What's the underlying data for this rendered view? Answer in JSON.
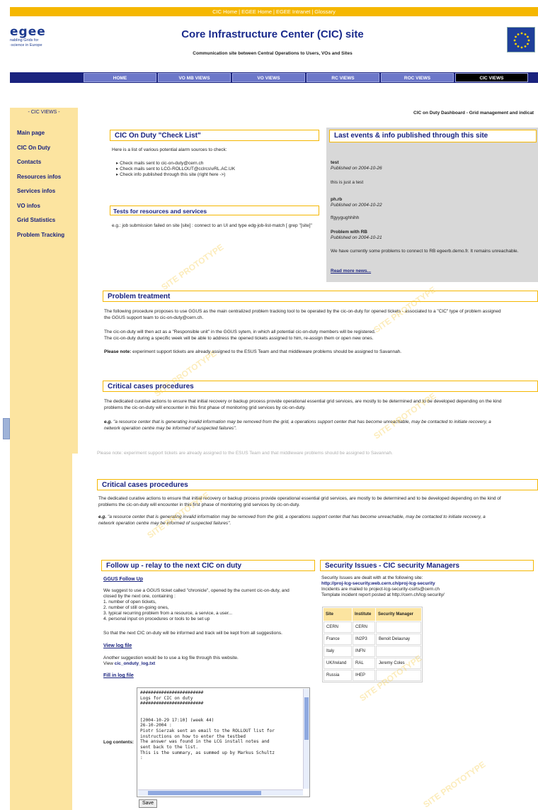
{
  "topbar": {
    "links": [
      "CIC Home",
      "EGEE Home",
      "EGEE Intranet",
      "Glossary"
    ],
    "separator": "|"
  },
  "logo": {
    "word": "egee",
    "tagline_1": "nabling Grids for",
    "tagline_2": "-science in Europe"
  },
  "header": {
    "title": "Core Infrastructure Center (CIC) site",
    "subtitle": "Communication site between Central Operations to Users, VOs and Sites"
  },
  "nav": {
    "items": [
      "HOME",
      "VO MB VIEWS",
      "VO VIEWS",
      "RC VIEWS",
      "ROC VIEWS",
      "CIC VIEWS"
    ],
    "active": "CIC VIEWS"
  },
  "sidebar": {
    "title": "- CIC VIEWS -",
    "items": [
      "Main page",
      "CIC On Duty",
      "Contacts",
      "Resources infos",
      "Services infos",
      "VO infos",
      "Grid Statistics",
      "Problem Tracking"
    ]
  },
  "breadcrumb": "CIC on Duty Dashboard - Grid management and indicat",
  "checklist": {
    "title": "CIC On Duty \"Check List\"",
    "intro": "Here is a list of various potential alarm sources to check:",
    "items": [
      "Check mails sent to cic-on-duty@cern.ch",
      "Check mails sent to LCG-ROLLOUT@cclrcs\\vRL.AC.UK",
      "Check info published through this site (right here ->)"
    ]
  },
  "tests": {
    "title": "Tests for resources and services",
    "text": "e.g.: job submission failed on site [site] : connect to an UI and type edg-job-list-match [ grep \"[site]\""
  },
  "events": {
    "title": "Last events & info published through this site",
    "entries": [
      {
        "name": "test",
        "published": "Published on 2004-10-26",
        "body": "this is just a test"
      },
      {
        "name": "ph.rb",
        "published": "Published on 2004-10-22",
        "body": "ffgyygughhihh"
      },
      {
        "name": "Problem with RB",
        "published": "Published on 2004-10-21",
        "body": "We have currently some problems to connect to RB egeerb.demo.fr. It remains unreachable."
      }
    ],
    "more": "Read more news..."
  },
  "problem": {
    "title": "Problem treatment",
    "p1": "The following procedure proposes to use GGUS as the main centralized problem tracking tool to be operated by the cic-on-duty for opened tickets - associated to a \"CIC\" type of problem assigned",
    "p1b": "the GGUS support team to cic-on-duty@cern.ch.",
    "p2": "The cic-on-duty will then act as a \"Responsible unit\" in the GGUS sytem, in which all potential cic-on-duty members will be registered.",
    "p3": "The cic-on-duty during a specific week will be able to address the opened tickets assigned to him, re-assign them or open new ones.",
    "note_label": "Please note:",
    "note": "experiment support tickets are already assigned to the ESUS Team and that middleware problems should be assigned to Savannah."
  },
  "critical": {
    "title": "Critical cases procedures",
    "p1": "The dedicated curative actions to ensure that initial recovery or backup process provide operational essential grid services, are mostly to be determined and to be developed depending on the kind",
    "p1b": "problems the cic-on-duty will encounter in this first phase of monitoring grid services by cic-on-duty.",
    "eg_label": "e.g.",
    "eg": "\"a resource center that is generating invalid information may be removed from the grid, a operations support center that has become unreachable, may be contacted to initiate recovery, a",
    "eg2": "network operation centre may be informed of suspected failures\"."
  },
  "critical2": {
    "title": "Critical cases procedures",
    "p1": "The dedicated curative actions to ensure that initial recovery or backup process provide operational essential grid services, are mostly to be determined and to be developed depending on the kind of",
    "p1b": "problems the cic-on-duty will encounter in this first phase of monitoring grid services by cic-on-duty.",
    "eg_label": "e.g.",
    "eg": "\"a resource center that is generating invalid information may be removed from the grid, a operations support center that has become unreachable, may be contacted to initiate recovery, a",
    "eg2": "network operation centre may be informed of suspected failures\".",
    "cut_line": "Please note: experiment support tickets are already assigned to the ESUS Team and that middleware problems should be assigned to Savannah."
  },
  "followup": {
    "title": "Follow up - relay to the next CIC on duty",
    "ggus_link": "GGUS Follow Up",
    "intro1": "We suggest to use a GGUS ticket called \"chronicle\", opened by the current cic-on-duty, and",
    "intro2": "closed by the next one, containing :",
    "list": [
      "1. number of open tickets,",
      "2. number of still on-going ones,",
      "3. typical recurring problem from a resource, a service, a user...",
      "4. personal input on procedures or tools to be set up"
    ],
    "outro": "So that the next CIC on-duty will be informed and track will be kept from all suggestions.",
    "view_log": "View log file",
    "another1": "Another suggestion would be to use a log file through this website.",
    "another2_prefix": "View",
    "another2_link": "cic_onduty_log.txt",
    "fill_log": "Fill in log file",
    "log_label": "Log contents:",
    "log_text": "########################\nLogs for CIC on duty\n########################\n\n\n[2004-10-29 17:10] (week 44)\n26-10-2004 :\nPiotr Sierzak sent an email to the ROLLOUT list for\ninstructions on how to enter the testbed\nThe answer was found in the LCG install notes and\nsent back to the list.\nThis is the summary, as summed up by Markus Schultz\n:",
    "save": "Save"
  },
  "security": {
    "title": "Security Issues - CIC security Managers",
    "line1": "Security Issues are dealt with at the following site:",
    "line2": "http://proj-lcg-security.web.cern.ch/proj-lcg-security",
    "line3": "Incidents are mailed to project-lcg-security-csirts@cern.ch",
    "line4": "Template incident report posted at http://cern.ch/lcg-security/",
    "headers": [
      "Site",
      "Institute",
      "Security Manager"
    ],
    "rows": [
      [
        "CERN",
        "CERN",
        ""
      ],
      [
        "France",
        "IN2P3",
        "Benoit Delaunay"
      ],
      [
        "Italy",
        "INFN",
        ""
      ],
      [
        "UK/Ireland",
        "RAL",
        "Jeremy Coles"
      ],
      [
        "Russia",
        "IHEP",
        ""
      ]
    ]
  },
  "watermark": "SITE PROTOTYPE",
  "colors": {
    "accent": "#f5b700",
    "nav": "#1a237e",
    "sidebar": "#fce4a0",
    "panel": "#d8d8d8"
  }
}
